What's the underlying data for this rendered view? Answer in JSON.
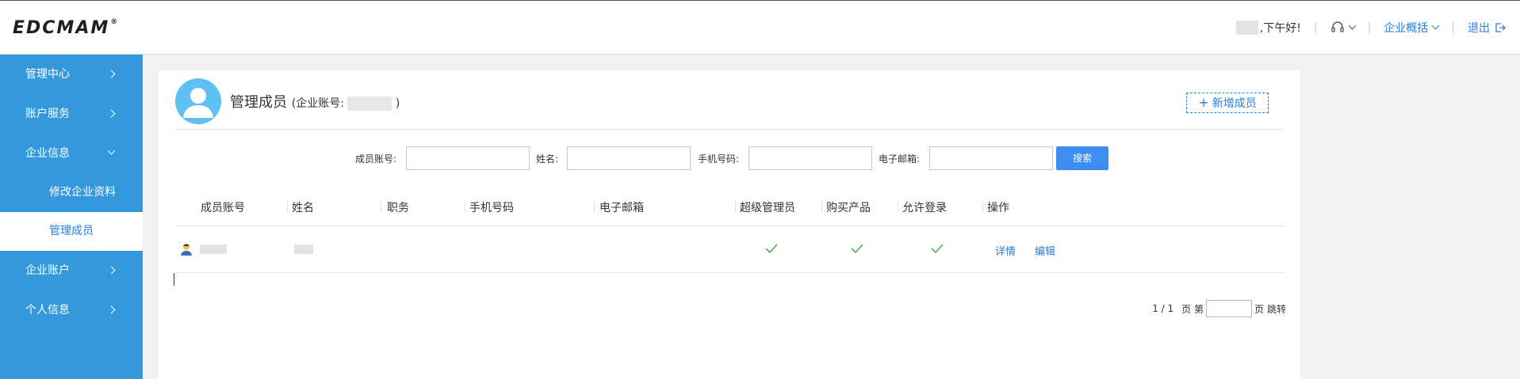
{
  "header": {
    "logo": "EDCMAM",
    "logo_reg": "®",
    "greeting": ",下午好!",
    "overview_label": "企业概括",
    "logout_label": "退出"
  },
  "sidebar": {
    "items": [
      {
        "label": "管理中心"
      },
      {
        "label": "账户服务"
      },
      {
        "label": "企业信息"
      },
      {
        "label": "修改企业资料"
      },
      {
        "label": "管理成员"
      },
      {
        "label": "企业账户"
      },
      {
        "label": "个人信息"
      }
    ]
  },
  "main": {
    "title": "管理成员",
    "account_prefix": "(企业账号:",
    "account_suffix": ")",
    "add_button": "新增成员",
    "search": {
      "account_label": "成员账号:",
      "name_label": "姓名:",
      "phone_label": "手机号码:",
      "email_label": "电子邮箱:",
      "button": "搜索"
    },
    "table": {
      "headers": [
        "成员账号",
        "姓名",
        "职务",
        "手机号码",
        "电子邮箱",
        "超级管理员",
        "购买产品",
        "允许登录",
        "操作"
      ],
      "row": {
        "detail": "详情",
        "edit": "编辑"
      }
    },
    "pager": {
      "page_info": "1 / 1",
      "page_label": "页 第",
      "page_suffix": "页",
      "jump": "跳转"
    }
  },
  "colors": {
    "sidebar": "#3398dc",
    "accent": "#2b7ed9",
    "search_button": "#3d8ef0",
    "check": "#4caf50",
    "avatar": "#5ec0f3"
  }
}
